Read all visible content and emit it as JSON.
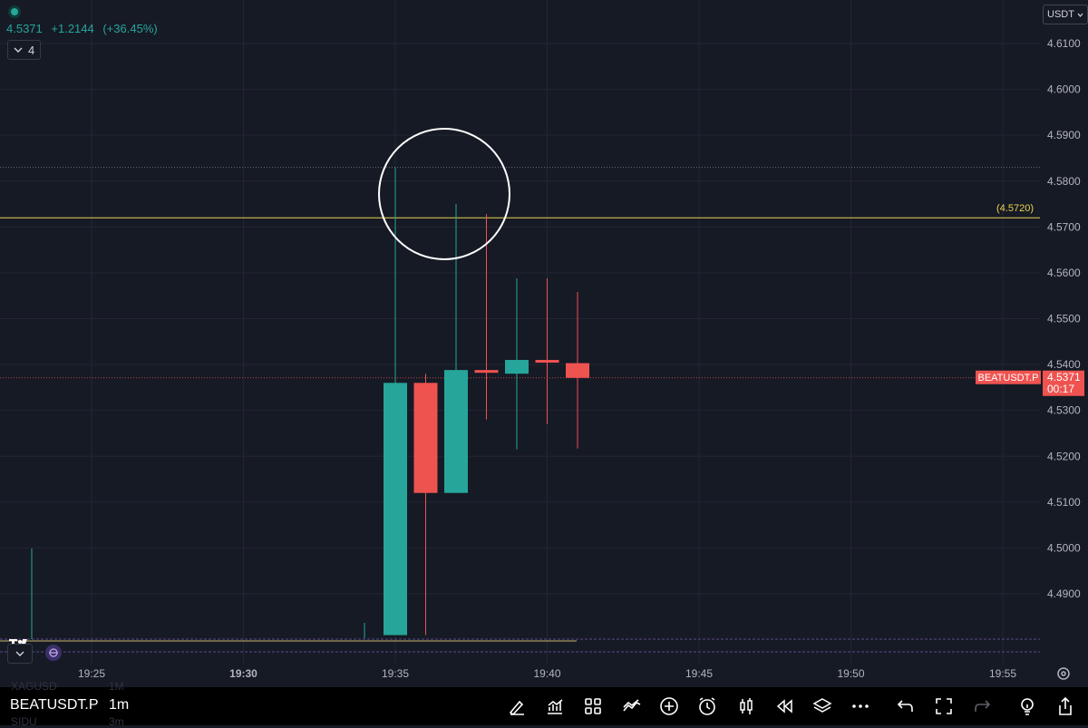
{
  "header": {
    "last_price": "4.5371",
    "change": "+1.2144",
    "change_pct": "(+36.45%)",
    "indicators_count": "4",
    "currency": "USDT"
  },
  "colors": {
    "up": "#26a69a",
    "down": "#ef5350",
    "background": "#161a25",
    "grid": "#232632",
    "alert_line": "#e8d44d",
    "annotation_circle": "#ffffff"
  },
  "chart_data": {
    "type": "candlestick",
    "symbol": "BEATUSDT.P",
    "interval": "1m",
    "y_ticks": [
      "4.6100",
      "4.6000",
      "4.5900",
      "4.5800",
      "4.5700",
      "4.5600",
      "4.5500",
      "4.5400",
      "4.5300",
      "4.5200",
      "4.5100",
      "4.5000",
      "4.4900"
    ],
    "x_ticks": [
      "19:25",
      "19:30",
      "19:35",
      "19:40",
      "19:45",
      "19:50",
      "19:55"
    ],
    "ylim": [
      4.481,
      4.615
    ],
    "candles": [
      {
        "time": "19:35",
        "open": 4.481,
        "high": 4.583,
        "low": 4.481,
        "close": 4.536
      },
      {
        "time": "19:36",
        "open": 4.536,
        "high": 4.538,
        "low": 4.481,
        "close": 4.512
      },
      {
        "time": "19:37",
        "open": 4.512,
        "high": 4.575,
        "low": 4.512,
        "close": 4.5388
      },
      {
        "time": "19:38",
        "open": 4.5388,
        "high": 4.5728,
        "low": 4.528,
        "close": 4.5382
      },
      {
        "time": "19:39",
        "open": 4.538,
        "high": 4.5588,
        "low": 4.5215,
        "close": 4.541
      },
      {
        "time": "19:40",
        "open": 4.541,
        "high": 4.5588,
        "low": 4.527,
        "close": 4.5405
      },
      {
        "time": "19:41",
        "open": 4.5403,
        "high": 4.5558,
        "low": 4.5217,
        "close": 4.5371
      }
    ],
    "alert_level": {
      "value": 4.572,
      "label": "(4.5720)"
    },
    "last_price_label": {
      "symbol": "BEATUSDT.P",
      "price": "4.5371",
      "countdown": "00:17"
    },
    "grid": true
  },
  "bottom_bar": {
    "symbol": "BEATUSDT.P",
    "interval": "1m",
    "ghost_above_symbol": "XAGUSD",
    "ghost_above_interval": "1M",
    "ghost_below_symbol": "SIDU",
    "ghost_below_interval": "3m",
    "tools": [
      "drawing-pen-icon",
      "chart-type-icon",
      "grid-layout-icon",
      "indicators-icon",
      "add-icon",
      "alert-clock-icon",
      "candles-icon",
      "replay-icon",
      "layers-icon",
      "more-icon",
      "undo-icon",
      "fullscreen-icon",
      "redo-icon",
      "ideas-bulb-icon",
      "share-icon"
    ]
  }
}
